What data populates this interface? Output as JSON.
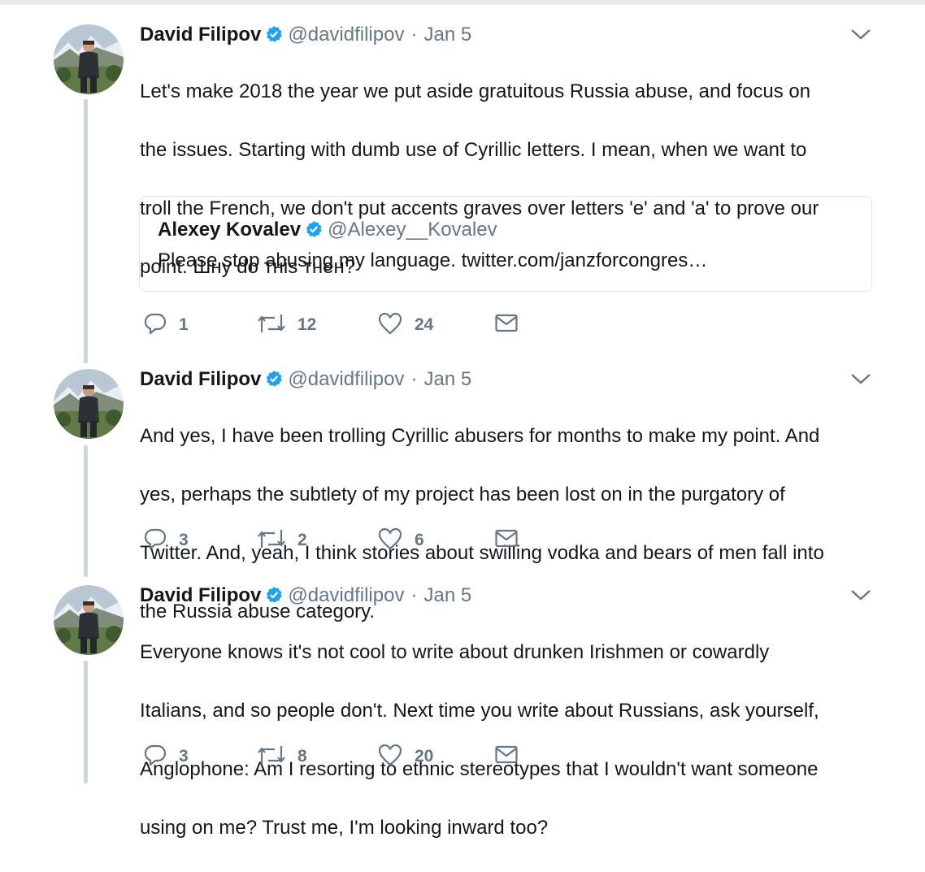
{
  "tweets": [
    {
      "author": "David Filipov",
      "handle": "@davidfilipov",
      "separator": "·",
      "date": "Jan 5",
      "lines": [
        "Let's make 2018 the year we put aside gratuitous Russia abuse, and focus on",
        "the issues. Starting with dumb use of Cyrillic letters. I mean, when we want to",
        "troll the French, we don't put accents graves over letters 'e' and 'a' to prove our",
        "point. Шну do тнis тнен?"
      ],
      "quote": {
        "author": "Alexey Kovalev",
        "handle": "@Alexey__Kovalev",
        "text": "Please stop abusing my language. twitter.com/janzforcongres…"
      },
      "replies": "1",
      "retweets": "12",
      "likes": "24"
    },
    {
      "author": "David Filipov",
      "handle": "@davidfilipov",
      "separator": "·",
      "date": "Jan 5",
      "lines": [
        "And yes, I have been trolling Cyrillic abusers for months to make my point. And",
        "yes, perhaps the subtlety of my project has been lost on in the purgatory of",
        "Twitter. And, yeah, I think stories about swilling vodka and bears of men fall into",
        "the Russia abuse category."
      ],
      "replies": "3",
      "retweets": "2",
      "likes": "6"
    },
    {
      "author": "David Filipov",
      "handle": "@davidfilipov",
      "separator": "·",
      "date": "Jan 5",
      "lines": [
        "Everyone knows it's not cool to write about drunken Irishmen or cowardly",
        "Italians, and so people don't. Next time you write about Russians, ask yourself,",
        "Anglophone: Am I resorting to ethnic stereotypes that I wouldn't want someone",
        "using on me? Trust me, I'm looking inward too?"
      ],
      "replies": "3",
      "retweets": "8",
      "likes": "20"
    }
  ],
  "icons": {
    "verified": "verified-badge-icon",
    "caret": "chevron-down-icon",
    "reply": "reply-icon",
    "retweet": "retweet-icon",
    "like": "heart-icon",
    "dm": "envelope-icon"
  },
  "colors": {
    "text": "#14171a",
    "secondary": "#657786",
    "verified": "#1da1f2",
    "thread_line": "#ccd6dd",
    "border": "#e1e8ed"
  }
}
